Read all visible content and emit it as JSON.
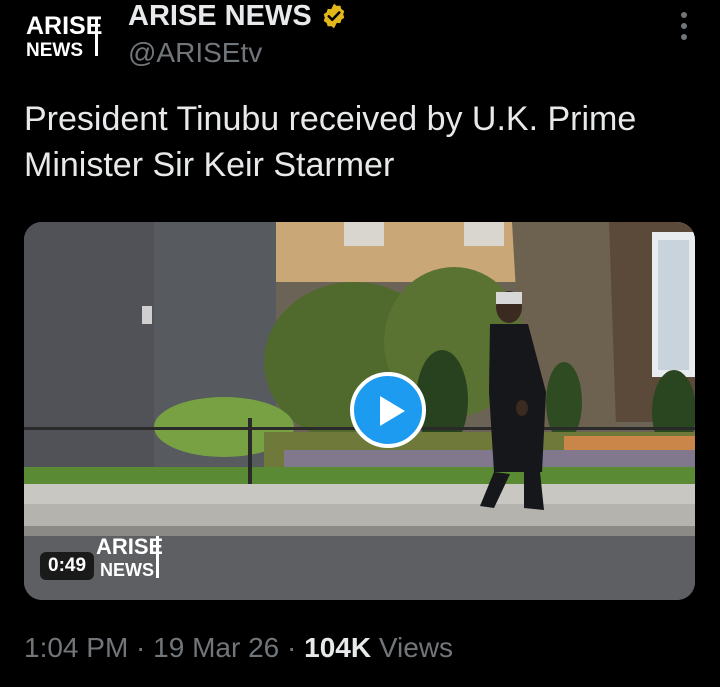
{
  "header": {
    "avatar_top": "ARISE",
    "avatar_bottom": "NEWS",
    "display_name": "ARISE NEWS",
    "handle": "@ARISEtv",
    "verified_icon": "verified-badge-icon",
    "more_icon": "more-vertical-icon"
  },
  "tweet": {
    "text_line1": "President Tinubu received by U.K. Prime",
    "text_line2": "Minister Sir Keir Starmer"
  },
  "media": {
    "duration": "0:49",
    "watermark_top": "ARISE",
    "watermark_bottom": "NEWS",
    "play_icon": "play-icon"
  },
  "meta": {
    "time": "1:04 PM",
    "sep1": " · ",
    "date": "19 Mar 26",
    "sep2": " · ",
    "views": "104K",
    "views_label": " Views"
  },
  "colors": {
    "background": "#000000",
    "text": "#e7e9ea",
    "muted": "#71767b",
    "accent": "#1d9bf0",
    "verified_gold": "#e2b719"
  }
}
